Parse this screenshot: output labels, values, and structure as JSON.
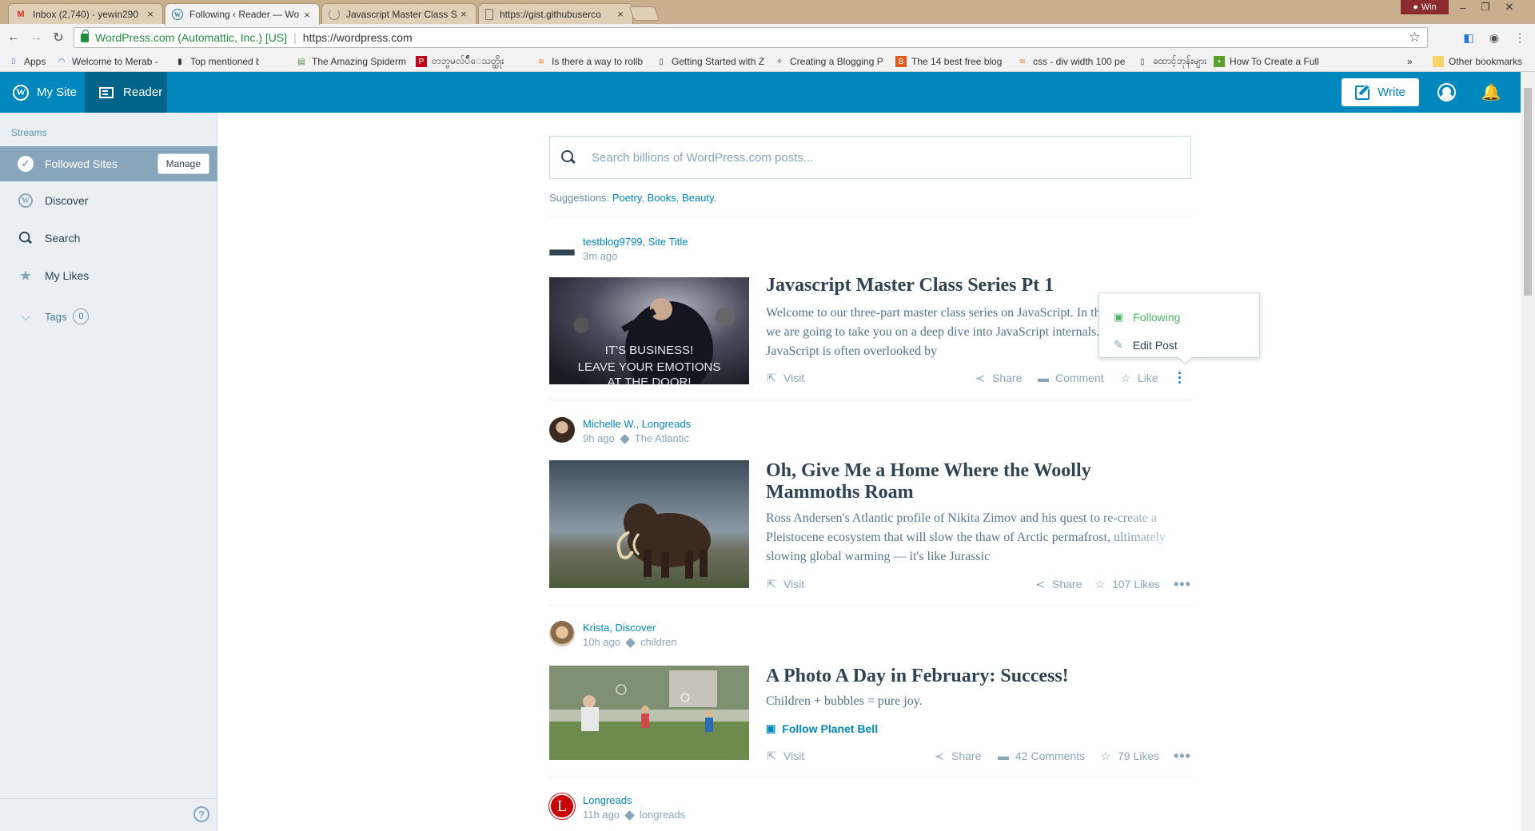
{
  "browser": {
    "tabs": [
      {
        "title": "Inbox (2,740) - yewin290",
        "icon": "gmail-icon"
      },
      {
        "title": "Following ‹ Reader — Wo",
        "icon": "wordpress-icon"
      },
      {
        "title": "Javascript Master Class S",
        "icon": "loading-icon"
      },
      {
        "title": "https://gist.githubuserco",
        "icon": "page-icon"
      }
    ],
    "user_badge": "Win",
    "secure_label": "WordPress.com (Automattic, Inc.) [US]",
    "url": "https://wordpress.com",
    "bookmarks": [
      "Apps",
      "Welcome to Merab -",
      "Top mentioned book:",
      "The Amazing Spiderm",
      "တဘ္ဗမလ်ပ်ဳေသတ္ထိုး",
      "Is there a way to rollb",
      "Getting Started with Z",
      "Creating a Blogging P",
      "The 14 best free blog",
      "css - div width 100 pe",
      "ထောင့်ဘုန်းများ",
      "How To Create a Full"
    ],
    "more_bookmarks": "»",
    "other_bookmarks": "Other bookmarks"
  },
  "masterbar": {
    "my_site": "My Site",
    "reader": "Reader",
    "write": "Write"
  },
  "sidebar": {
    "heading": "Streams",
    "items": [
      {
        "label": "Followed Sites",
        "manage": "Manage"
      },
      {
        "label": "Discover"
      },
      {
        "label": "Search"
      },
      {
        "label": "My Likes"
      },
      {
        "label": "Tags",
        "count": "0"
      }
    ]
  },
  "search": {
    "placeholder": "Search billions of WordPress.com posts...",
    "suggestions_label": "Suggestions:",
    "suggestions": [
      "Poetry",
      "Books",
      "Beauty"
    ]
  },
  "posts": [
    {
      "author": "testblog9799, Site Title",
      "time": "3m ago",
      "tag": "",
      "title": "Javascript Master Class Series Pt 1",
      "excerpt": "Welcome to our three-part master class series on JavaScript. In this course series, we are going to take you on a deep dive into JavaScript internals. Core JavaScript is often overlooked by",
      "thumb_caption": "IT'S BUSINESS! LEAVE YOUR EMOTIONS AT THE DOOR!",
      "visit": "Visit",
      "share": "Share",
      "comment": "Comment",
      "like": "Like"
    },
    {
      "author": "Michelle W., Longreads",
      "time": "9h ago",
      "tag": "The Atlantic",
      "title": "Oh, Give Me a Home Where the Woolly Mammoths Roam",
      "excerpt": "Ross Andersen's Atlantic profile of Nikita Zimov and his quest to re-create a Pleistocene ecosystem that will slow the thaw of Arctic permafrost, ultimately slowing global warming — it's like Jurassic",
      "visit": "Visit",
      "share": "Share",
      "likes": "107 Likes"
    },
    {
      "author": "Krista, Discover",
      "time": "10h ago",
      "tag": "children",
      "title": "A Photo A Day in February: Success!",
      "excerpt": "Children + bubbles = pure joy.",
      "follow": "Follow Planet Bell",
      "visit": "Visit",
      "share": "Share",
      "comments": "42 Comments",
      "likes": "79 Likes"
    },
    {
      "author": "Longreads",
      "time": "11h ago",
      "tag": "longreads"
    }
  ],
  "popover": {
    "following": "Following",
    "edit_post": "Edit Post"
  },
  "colors": {
    "brand": "#0087be",
    "brand_dark": "#00638a",
    "following_green": "#4ab866"
  }
}
